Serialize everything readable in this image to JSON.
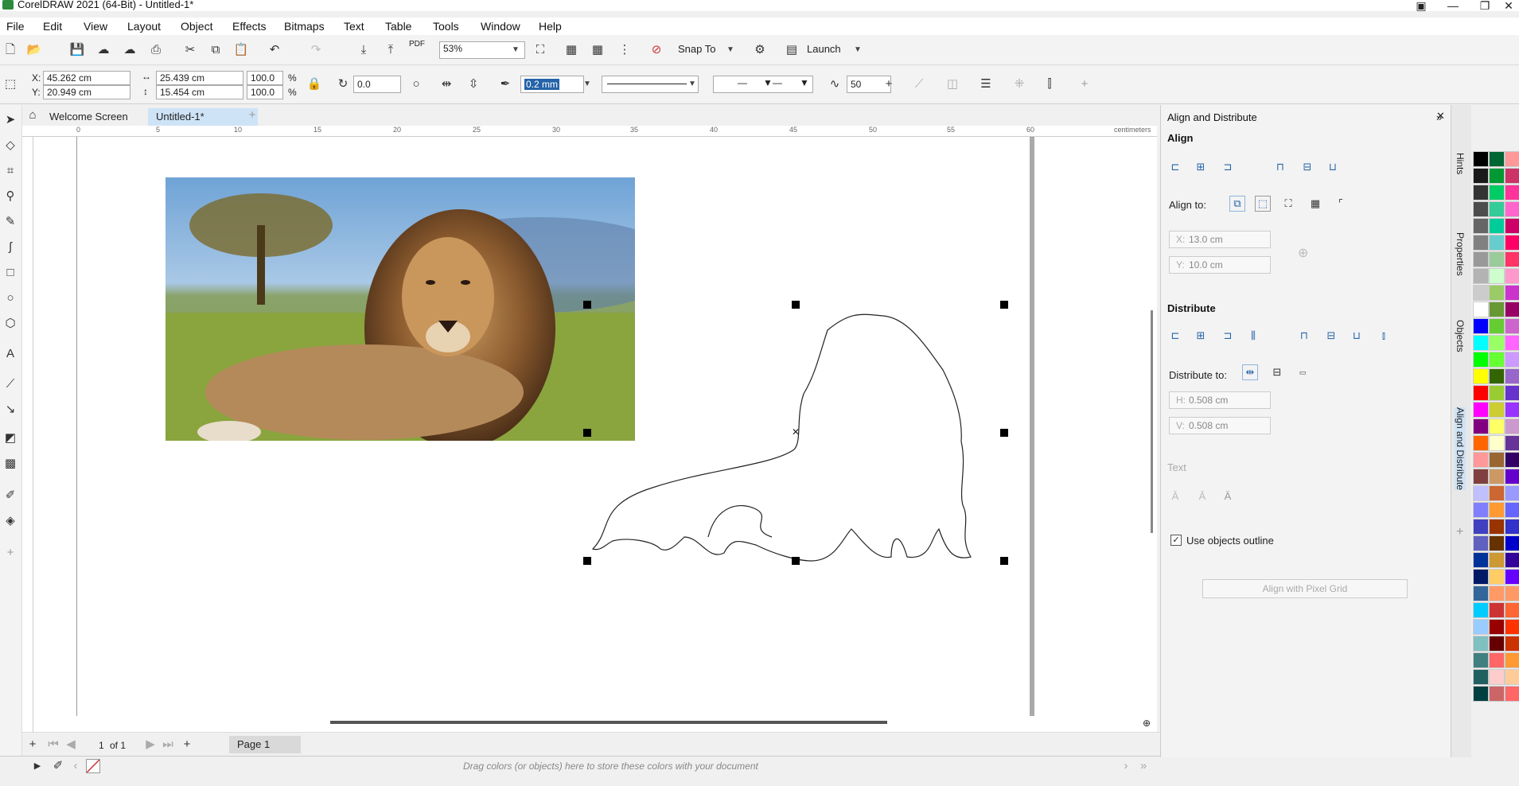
{
  "window": {
    "title": "CorelDRAW 2021 (64-Bit) - Untitled-1*"
  },
  "menu": [
    "File",
    "Edit",
    "View",
    "Layout",
    "Object",
    "Effects",
    "Bitmaps",
    "Text",
    "Table",
    "Tools",
    "Window",
    "Help"
  ],
  "toolbar1": {
    "zoom": "53%",
    "snap": "Snap To",
    "launch": "Launch",
    "pdf": "PDF"
  },
  "toolbar2": {
    "x_label": "X:",
    "x": "45.262 cm",
    "y_label": "Y:",
    "y": "20.949 cm",
    "w": "25.439 cm",
    "h": "15.454 cm",
    "sx": "100.0",
    "sy": "100.0",
    "pct": "%",
    "rotation": "0.0",
    "outline_width": "0.2 mm",
    "smooth": "50"
  },
  "tabs": {
    "welcome": "Welcome Screen",
    "doc": "Untitled-1*"
  },
  "ruler": {
    "unit": "centimeters",
    "ticks": [
      "0",
      "5",
      "10",
      "15",
      "20",
      "25",
      "30",
      "35",
      "40",
      "45",
      "50",
      "55",
      "60"
    ]
  },
  "pagenav": {
    "pageinfo": "1",
    "of": "of 1",
    "page": "Page 1"
  },
  "status": {
    "palette_hint": "Drag colors (or objects) here to store these colors with your document"
  },
  "docker": {
    "title": "Align and Distribute",
    "align": "Align",
    "align_to": "Align to:",
    "x_label": "X:",
    "x": "13.0 cm",
    "y_label": "Y:",
    "y": "10.0 cm",
    "distribute": "Distribute",
    "distribute_to": "Distribute to:",
    "h_label": "H:",
    "h": "0.508 cm",
    "v_label": "V:",
    "v": "0.508 cm",
    "text": "Text",
    "use_outline": "Use objects outline",
    "pixel_grid": "Align with Pixel Grid"
  },
  "sidetabs": [
    "Hints",
    "Properties",
    "Objects",
    "Align and Distribute"
  ],
  "colors": {
    "accent": "#2563a8",
    "palette": [
      "#000000",
      "#1a1a1a",
      "#333333",
      "#4d4d4d",
      "#666666",
      "#808080",
      "#999999",
      "#b3b3b3",
      "#cccccc",
      "#ffffff",
      "#0000ff",
      "#00ffff",
      "#00ff00",
      "#ffff00",
      "#ff0000",
      "#ff00ff",
      "#800080",
      "#ff6600",
      "#ff9999",
      "#804040",
      "#c0c0ff",
      "#8080ff",
      "#4040c0",
      "#6060c0",
      "#003399",
      "#001a66",
      "#336699",
      "#00ccff",
      "#99ccff",
      "#80c0c0",
      "#408080",
      "#206060",
      "#004040"
    ],
    "palette2": [
      "#006633",
      "#009933",
      "#00cc66",
      "#33cc99",
      "#00cc99",
      "#66cccc",
      "#99cc99",
      "#ccffcc",
      "#99cc66",
      "#669933",
      "#66cc33",
      "#99ff66",
      "#66ff33",
      "#336600",
      "#99cc33",
      "#cccc33",
      "#ffff66",
      "#ffffcc",
      "#996633",
      "#cc9966",
      "#cc6633",
      "#ff9933",
      "#993300",
      "#663300",
      "#cc9933",
      "#ffcc66",
      "#ff9966",
      "#cc3333",
      "#990000",
      "#660000",
      "#ff6666",
      "#ffcccc",
      "#cc6666"
    ],
    "palette3": [
      "#ff9999",
      "#cc3366",
      "#ff3399",
      "#ff66cc",
      "#cc0066",
      "#ff0066",
      "#ff3366",
      "#ff99cc",
      "#cc33cc",
      "#990066",
      "#cc66cc",
      "#ff66ff",
      "#cc99ff",
      "#9966cc",
      "#6633cc",
      "#9933ff",
      "#cc99cc",
      "#663399",
      "#330066",
      "#6600cc",
      "#9999ff",
      "#6666ff",
      "#3333cc",
      "#0000cc",
      "#330099",
      "#6600ff",
      "#ff9966",
      "#ff6633",
      "#ff3300",
      "#cc3300",
      "#ff9933",
      "#ffcc99",
      "#ff6666"
    ]
  }
}
